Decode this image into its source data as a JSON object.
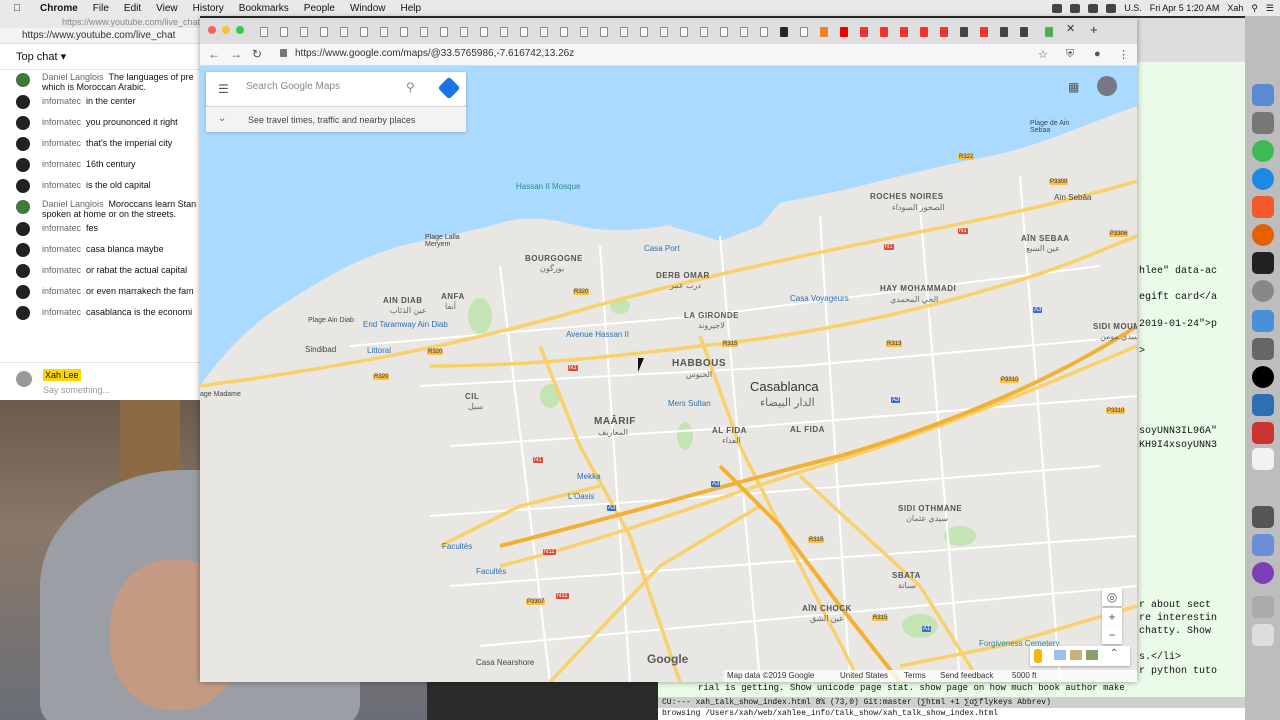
{
  "menubar": {
    "app": "Chrome",
    "items": [
      "File",
      "Edit",
      "View",
      "History",
      "Bookmarks",
      "People",
      "Window",
      "Help"
    ],
    "region": "U.S.",
    "datetime": "Fri Apr 5  1:20 AM",
    "user": "Xah"
  },
  "chat": {
    "url_top": "https://www.youtube.com/live_chat?is_p",
    "url": "https://www.youtube.com/live_chat",
    "header": "Top chat",
    "messages": [
      {
        "author": "Daniel Langlois",
        "text": "The languages of pre which is Moroccan Arabic."
      },
      {
        "author": "infomatec",
        "text": "in the center"
      },
      {
        "author": "infomatec",
        "text": "you prounonced it right"
      },
      {
        "author": "infomatec",
        "text": "that's the imperial city"
      },
      {
        "author": "infomatec",
        "text": "16th century"
      },
      {
        "author": "infomatec",
        "text": "is the old capital"
      },
      {
        "author": "Daniel Langlois",
        "text": "Moroccans learn Stan spoken at home or on the streets."
      },
      {
        "author": "infomatec",
        "text": "fes"
      },
      {
        "author": "infomatec",
        "text": "casa blanca maybe"
      },
      {
        "author": "infomatec",
        "text": "or rabat the actual capital"
      },
      {
        "author": "infomatec",
        "text": "or even marrakech the fam"
      },
      {
        "author": "infomatec",
        "text": "casablanca is the economi"
      }
    ],
    "composer_name": "Xah Lee",
    "composer_placeholder": "Say something..."
  },
  "browser": {
    "url": "https://www.google.com/maps/@33.5765986,-7.616742,13.26z"
  },
  "maps": {
    "search_placeholder": "Search Google Maps",
    "explore_text": "See travel times, traffic and nearby places",
    "logo": "Google",
    "footer": {
      "map_data": "Map data ©2019 Google",
      "country": "United States",
      "terms": "Terms",
      "feedback": "Send feedback",
      "scale": "5000 ft"
    },
    "labels": {
      "hassan_mosque": "Hassan II Mosque",
      "plage_lalla": "Plage Lalla Meryem",
      "bourgogne": "BOURGOGNE",
      "bourgogne_ar": "بورگون",
      "casa_port": "Casa Port",
      "derb_omar": "DERB OMAR",
      "derb_omar_ar": "درب عمر",
      "roches_noires": "ROCHES NOIRES",
      "roches_noires_ar": "الصخور السوداء",
      "ain_sebaa": "AÏN SEBAA",
      "ain_sebaa_ar": "عين السبع",
      "ain_sebaa_st": "Aïn Sebâa",
      "plage_ain_sebaa": "Plage de Ain Sebaa",
      "ain_diab": "AIN DIAB",
      "ain_diab_ar": "عين الذئاب",
      "anfa": "ANFA",
      "anfa_ar": "آنفا",
      "plage_ain_diab": "Plage Ain Diab",
      "end_tramway": "End Taramway Ain Diab",
      "sindibad": "Sindibad",
      "littoral": "Littoral",
      "la_gironde": "LA GIRONDE",
      "la_gironde_ar": "لاجيروند",
      "casa_voyageurs": "Casa Voyageurs",
      "hay_mohammadi": "HAY MOHAMMADI",
      "hay_mohammadi_ar": "الحي المحمدي",
      "avenue_hassan": "Avenue Hassan II",
      "habbous": "HABBOUS",
      "habbous_ar": "الحبوس",
      "casablanca": "Casablanca",
      "casablanca_ar": "الدار البيضاء",
      "sidi_moumen": "SIDI MOUMEN",
      "sidi_moumen_ar": "سيدي مومن",
      "cil": "CIL",
      "cil_ar": "سيل",
      "maarif": "MAÂRIF",
      "maarif_ar": "المعاريف",
      "mers_sultan": "Mers Sultan",
      "al_fida1": "AL FIDA",
      "al_fida1_ar": "الفداء",
      "al_fida2": "AL FIDA",
      "mekka": "Mekka",
      "loasis": "L'Oasis",
      "facultes1": "Facultés",
      "facultes2": "Facultés",
      "sidi_othmane": "SIDI OTHMANE",
      "sidi_othmane_ar": "سيدي عثمان",
      "sbata": "SBATA",
      "sbata_ar": "سباتة",
      "ain_chock": "AÏN CHOCK",
      "ain_chock_ar": "عين الشق",
      "forgiveness": "Forgiveness Cemetery",
      "casa_nearshore": "Casa Nearshore",
      "plage_madame": "age Madame"
    },
    "roads": [
      "R322",
      "R320",
      "R320",
      "R320",
      "R315",
      "R313",
      "R315",
      "N1",
      "N1",
      "N1",
      "N1",
      "N11",
      "N11",
      "P3307",
      "P3300",
      "P3310",
      "P3306",
      "P3310",
      "A3",
      "A3",
      "A3",
      "A3",
      "A1",
      "R315"
    ]
  },
  "editor": {
    "lines": [
      "hlee\" data-ac",
      "egift card</a",
      "2019-01-24\">p",
      ">",
      "soyUNN3IL96A\"",
      "KH9I4xsoyUNN3",
      "r about sect",
      "re interestin",
      "chatty. Show",
      "s.</li>",
      "r python tuto"
    ],
    "bottom_line": "rial is getting. Show unicode page stat. show page on how much book author make",
    "modeline": "CU:---  xah_talk_show_index.html    8% (73,0)     Git:master  (∑html +1 ∑α∑flykeys Abbrev)",
    "minibuffer": "browsing /Users/xah/web/xahlee_info/talk_show/xah_talk_show_index.html"
  }
}
